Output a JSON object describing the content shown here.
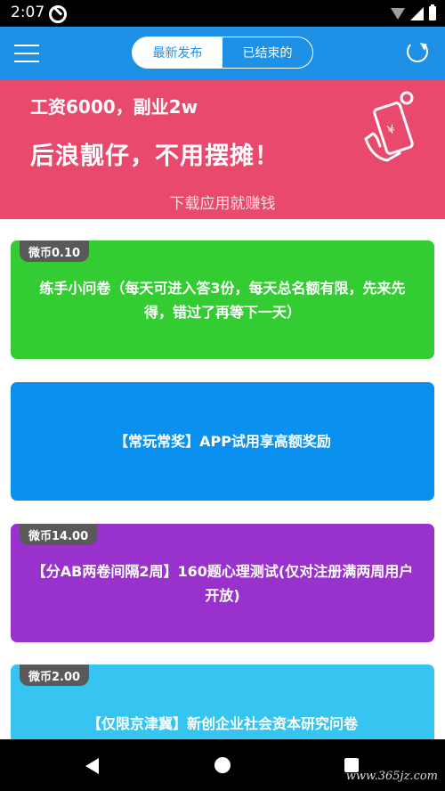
{
  "status_bar": {
    "time": "2:07"
  },
  "header": {
    "tabs": [
      {
        "label": "最新发布",
        "active": true
      },
      {
        "label": "已结束的",
        "active": false
      }
    ],
    "accent_color": "#1e91e6"
  },
  "banner": {
    "line1": "工资6000，副业2w",
    "line2": "后浪靓仔，不用摆摊！",
    "line3": "下载应用就赚钱",
    "color": "#e9496c"
  },
  "tasks": [
    {
      "badge": "微币0.10",
      "title": "练手小问卷（每天可进入答3份，每天总名额有限，先来先得，错过了再等下一天）",
      "color": "#33cc33"
    },
    {
      "badge": "",
      "title": "【常玩常奖】APP试用享高额奖励",
      "color": "#0a91f0"
    },
    {
      "badge": "微币14.00",
      "title": "【分AB两卷间隔2周】160题心理测试(仅对注册满两周用户开放)",
      "color": "#9932cc"
    },
    {
      "badge": "微币2.00",
      "title": "【仅限京津冀】新创企业社会资本研究问卷",
      "color": "#36c5f0"
    }
  ],
  "watermark": "www.365jz.com"
}
